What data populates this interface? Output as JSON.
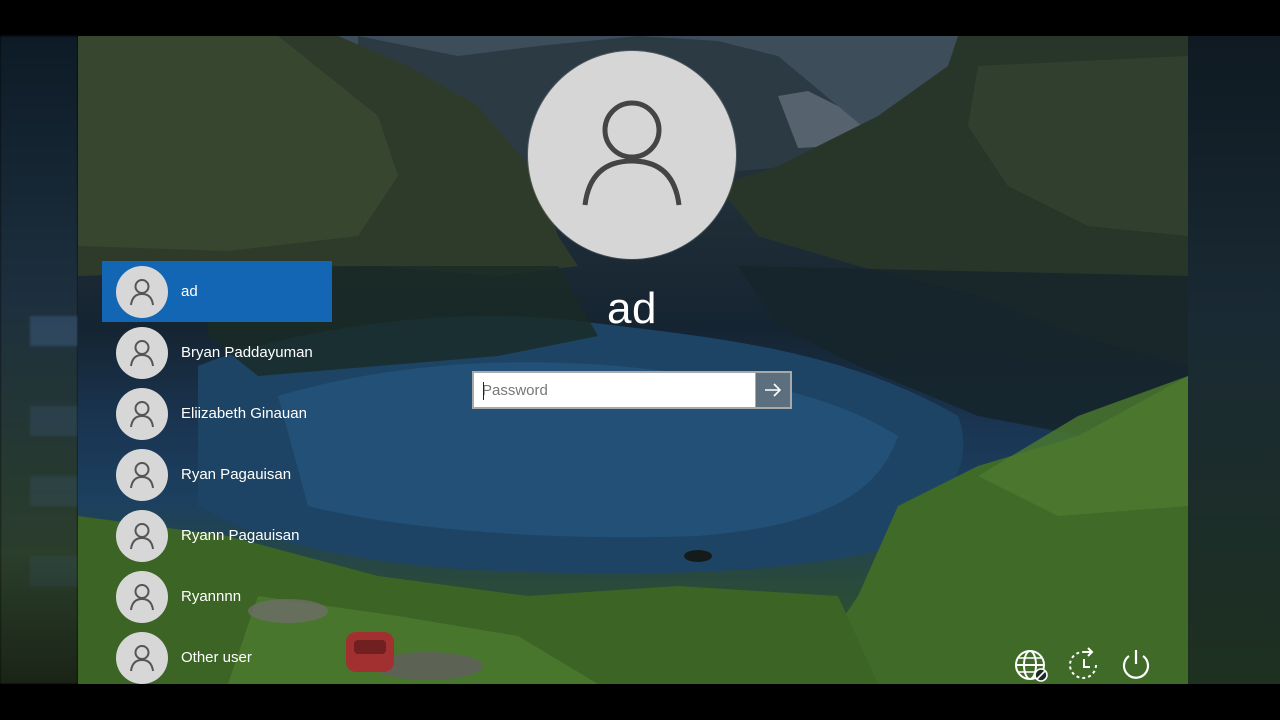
{
  "login": {
    "current_user": "ad",
    "password_placeholder": "Password",
    "password_value": ""
  },
  "users": [
    {
      "name": "ad",
      "selected": true
    },
    {
      "name": "Bryan Paddayuman",
      "selected": false
    },
    {
      "name": "Eliizabeth Ginauan",
      "selected": false
    },
    {
      "name": "Ryan Pagauisan",
      "selected": false
    },
    {
      "name": "Ryann Pagauisan",
      "selected": false
    },
    {
      "name": "Ryannnn",
      "selected": false
    },
    {
      "name": "Other user",
      "selected": false
    }
  ],
  "corner_icons": [
    "network-icon",
    "ease-of-access-icon",
    "power-icon"
  ],
  "colors": {
    "selected_user_bg": "#1366b3",
    "avatar_bg": "#d7d7d7",
    "submit_button": "#5c6f7f"
  }
}
